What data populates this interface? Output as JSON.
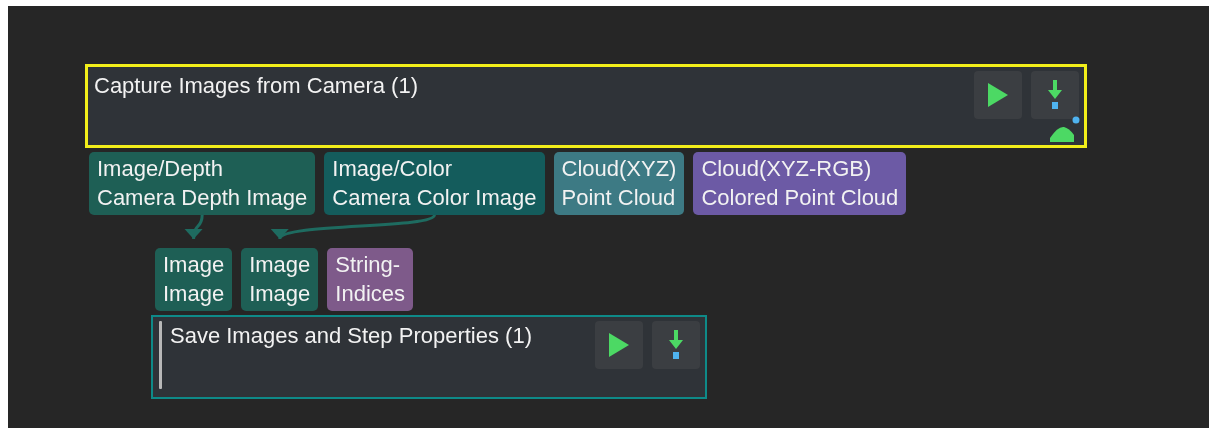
{
  "steps": [
    {
      "title": "Capture Images from Camera (1)",
      "selected": true,
      "has_output_badge": true,
      "outputs": [
        {
          "type": "Image/Depth",
          "name": "Camera Depth Image",
          "color": "#1e5f55"
        },
        {
          "type": "Image/Color",
          "name": "Camera Color Image",
          "color": "#145c5c"
        },
        {
          "type": "Cloud(XYZ)",
          "name": "Point Cloud",
          "color": "#3d7a84"
        },
        {
          "type": "Cloud(XYZ-RGB)",
          "name": "Colored Point Cloud",
          "color": "#6c5aa5"
        }
      ]
    },
    {
      "title": "Save Images and Step Properties (1)",
      "selected": false,
      "inputs": [
        {
          "type": "Image",
          "name": "Image",
          "color": "#1e5f55"
        },
        {
          "type": "Image",
          "name": "Image",
          "color": "#1e5f55"
        },
        {
          "type": "String-",
          "name": "Indices",
          "color": "#7e5a8a"
        }
      ]
    }
  ]
}
